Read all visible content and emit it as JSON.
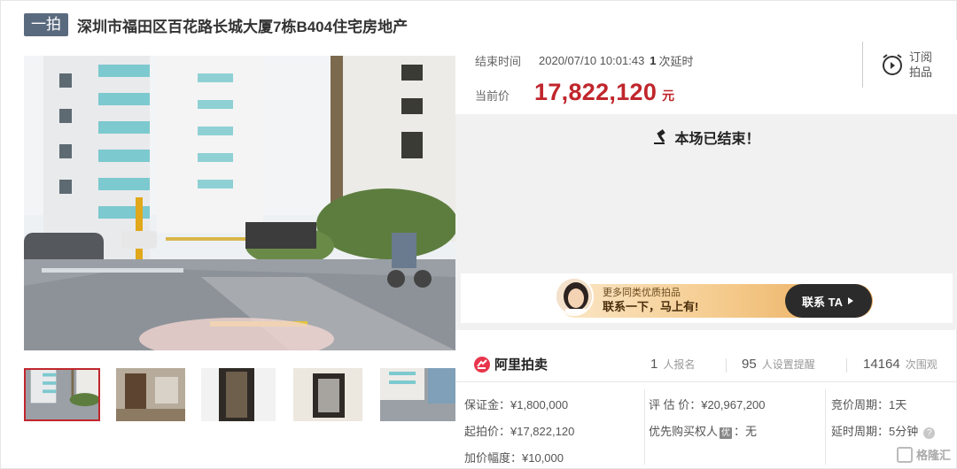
{
  "header": {
    "tag": "一拍",
    "title": "深圳市福田区百花路长城大厦7栋B404住宅房地产"
  },
  "auction": {
    "end_time_label": "结束时间",
    "end_time_value": "2020/07/10 10:01:43",
    "delay_count": "1",
    "delay_text": "次延时",
    "current_price_label": "当前价",
    "current_price": "17,822,120",
    "price_unit": "元",
    "subscribe_line1": "订阅",
    "subscribe_line2": "拍品",
    "status_message": "本场已结束！"
  },
  "contact": {
    "line1": "更多同类优质拍品",
    "line2": "联系一下，马上有!",
    "button": "联系 TA"
  },
  "stats": {
    "brand": "阿里拍卖",
    "signups_num": "1",
    "signups_label": "人报名",
    "reminders_num": "95",
    "reminders_label": "人设置提醒",
    "views_num": "14164",
    "views_label": "次围观"
  },
  "details": {
    "deposit": "保证金：¥1,800,000",
    "start_price": "起拍价：¥17,822,120",
    "increment": "加价幅度：¥10,000",
    "appraisal": "评 估 价：¥20,967,200",
    "priority_label": "优先购买权人",
    "priority_badge": "优",
    "priority_value": "：无",
    "bid_cycle": "竞价周期：1天",
    "delay_cycle": "延时周期：5分钟",
    "help_glyph": "?"
  },
  "watermark": "格隆汇",
  "colors": {
    "accent_red": "#c0262c",
    "tag_bg": "#5a6a7e",
    "status_bg": "#f1f1f1",
    "button_dark": "#2b2b2b"
  },
  "icons": {
    "subscribe": "alarm-clock-icon",
    "status": "gavel-icon",
    "brand": "alibaba-auction-logo",
    "contact_button_arrow": "play-arrow-icon",
    "help": "question-circle-icon"
  }
}
